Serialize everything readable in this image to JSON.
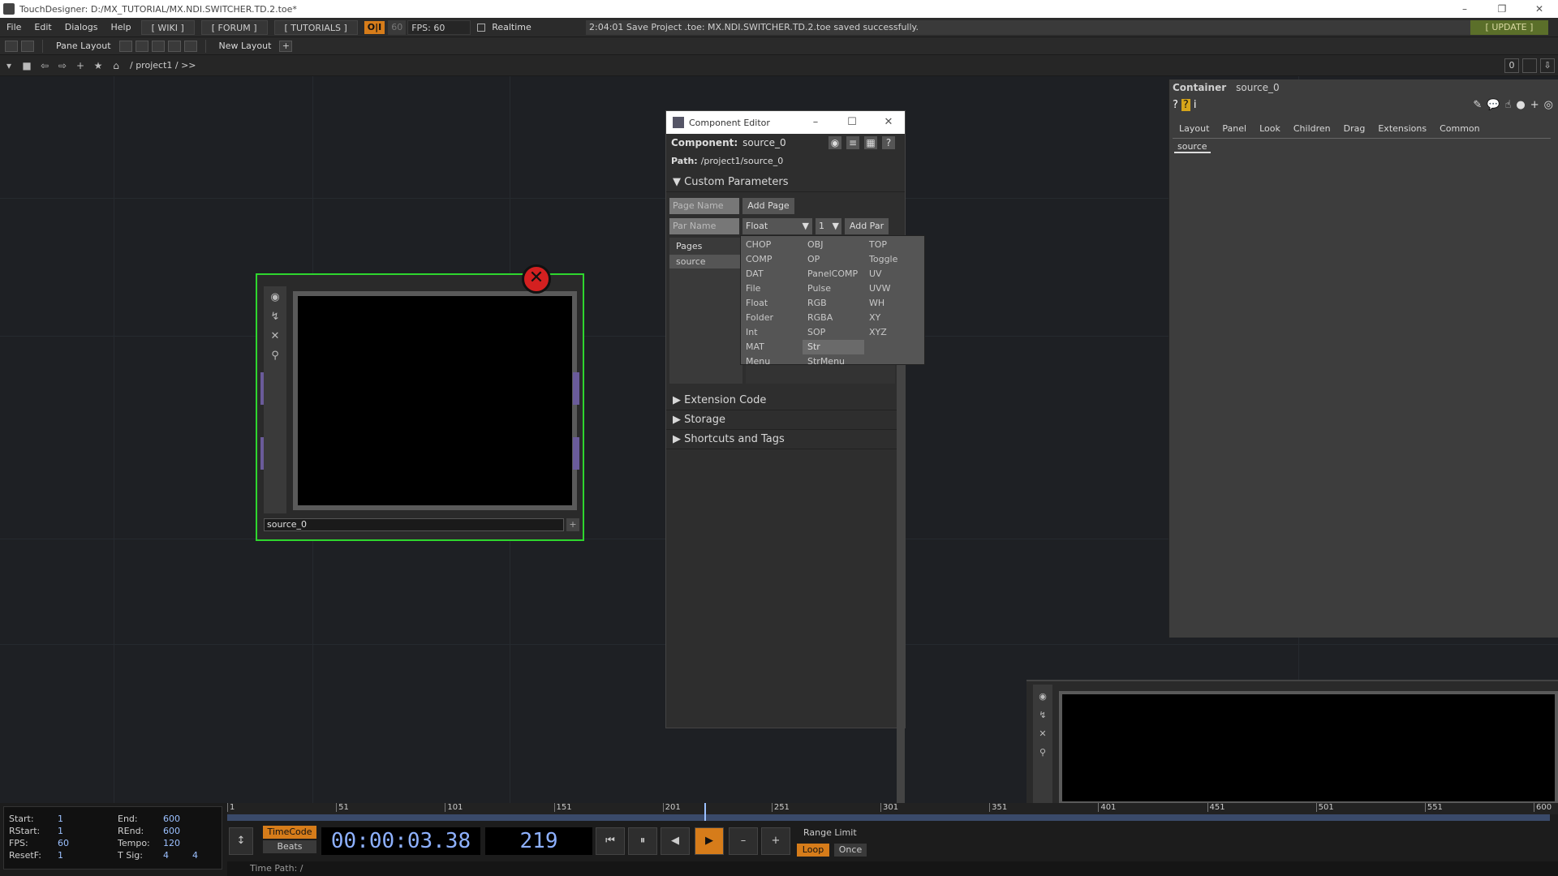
{
  "window": {
    "title": "TouchDesigner: D:/MX_TUTORIAL/MX.NDI.SWITCHER.TD.2.toe*",
    "minimize": "–",
    "restore": "❐",
    "close": "✕"
  },
  "menubar": {
    "items": [
      "File",
      "Edit",
      "Dialogs",
      "Help"
    ],
    "wiki": "[ WIKI ]",
    "forum": "[ FORUM ]",
    "tutorials": "[ TUTORIALS ]",
    "oi": "O|I",
    "fps_target": "60",
    "fps": "FPS:  60",
    "realtime": "Realtime",
    "status": "2:04:01 Save Project .toe: MX.NDI.SWITCHER.TD.2.toe saved successfully.",
    "update": "[ UPDATE ]"
  },
  "toolbar": {
    "pane_layout": "Pane Layout",
    "new_layout": "New Layout",
    "plus": "+"
  },
  "pathbar": {
    "path": "/ project1 / >>",
    "counter": "0"
  },
  "node": {
    "name": "source_0",
    "error": "✕"
  },
  "component_editor": {
    "title": "Component Editor",
    "component_label": "Component:",
    "component_value": "source_0",
    "path_label": "Path:",
    "path_value": "/project1/source_0",
    "custom_params": "Custom Parameters",
    "page_name_placeholder": "Page Name",
    "add_page": "Add Page",
    "par_name_placeholder": "Par Name",
    "type_value": "Float",
    "size_value": "1",
    "add_par": "Add Par",
    "pages_header": "Pages",
    "pages": [
      "source"
    ],
    "sections": [
      "Extension Code",
      "Storage",
      "Shortcuts and Tags"
    ],
    "dropdown": {
      "col1": [
        "CHOP",
        "COMP",
        "DAT",
        "File",
        "Float",
        "Folder",
        "Int",
        "MAT",
        "Menu"
      ],
      "col2": [
        "OBJ",
        "OP",
        "PanelCOMP",
        "Pulse",
        "RGB",
        "RGBA",
        "SOP",
        "Str",
        "StrMenu"
      ],
      "col3": [
        "TOP",
        "Toggle",
        "UV",
        "UVW",
        "WH",
        "XY",
        "XYZ"
      ],
      "selected": "Str"
    }
  },
  "param_panel": {
    "type": "Container",
    "name": "source_0",
    "tabs": [
      "Layout",
      "Panel",
      "Look",
      "Children",
      "Drag",
      "Extensions",
      "Common"
    ],
    "custom_tab": "source"
  },
  "timeline": {
    "info": {
      "start_label": "Start:",
      "start": "1",
      "end_label": "End:",
      "end": "600",
      "rstart_label": "RStart:",
      "rstart": "1",
      "rend_label": "REnd:",
      "rend": "600",
      "fps_label": "FPS:",
      "fps": "60",
      "tempo_label": "Tempo:",
      "tempo": "120",
      "resetf_label": "ResetF:",
      "resetf": "1",
      "tsig_label": "T Sig:",
      "tsig_a": "4",
      "tsig_b": "4"
    },
    "ticks": [
      "1",
      "51",
      "101",
      "151",
      "201",
      "251",
      "301",
      "351",
      "401",
      "451",
      "501",
      "551",
      "600"
    ],
    "timecode_btn": "TimeCode",
    "beats_btn": "Beats",
    "timecode": "00:00:03.38",
    "frame": "219",
    "range_limit": "Range Limit",
    "loop": "Loop",
    "once": "Once",
    "time_path": "Time Path: /",
    "play_progress": 0.365
  }
}
